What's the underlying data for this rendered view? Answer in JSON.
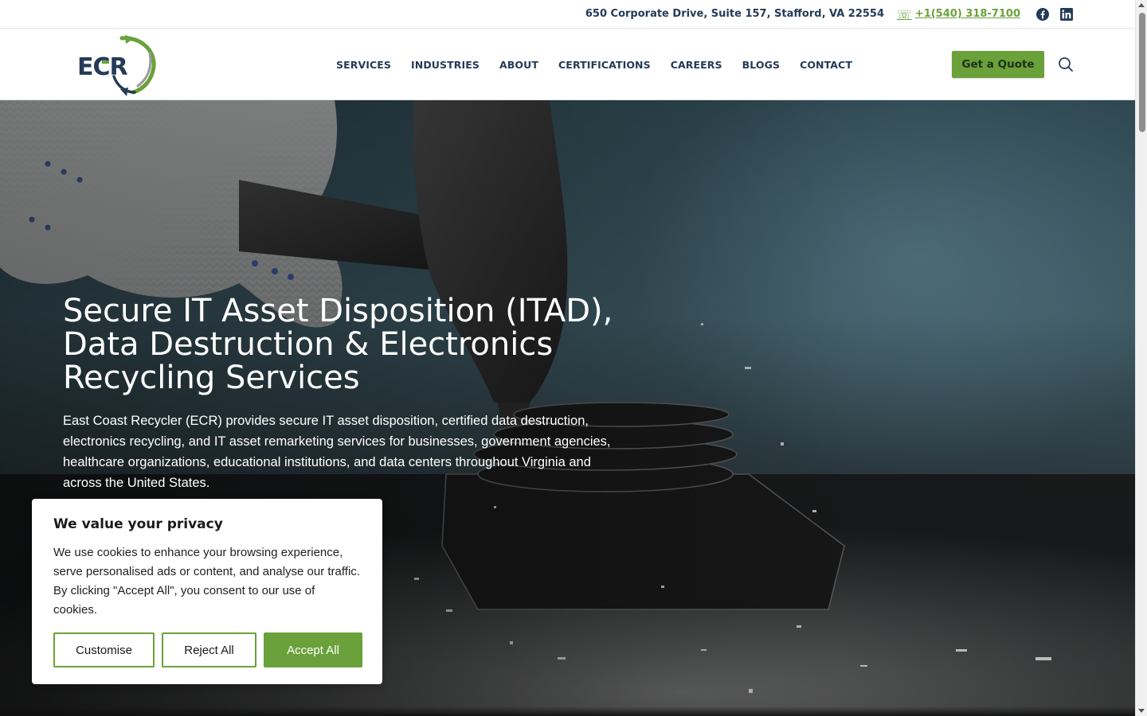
{
  "topbar": {
    "address": "650 Corporate Drive, Suite 157, Stafford, VA 22554",
    "phone_icon": "☏",
    "phone": "+1‪(540) 318-7100",
    "social": [
      "facebook-icon",
      "linkedin-icon"
    ]
  },
  "header": {
    "logo_text": "ECR",
    "nav": [
      "SERVICES",
      "INDUSTRIES",
      "ABOUT",
      "CERTIFICATIONS",
      "CAREERS",
      "BLOGS",
      "CONTACT"
    ],
    "quote_label": "Get a Quote",
    "search_icon": "search-icon"
  },
  "hero": {
    "title": "Secure IT Asset Disposition (ITAD), Data Destruction & Electronics Recycling Services",
    "description": "East Coast Recycler (ECR) provides secure IT asset disposition, certified data destruction, electronics recycling, and IT asset remarketing services for businesses, government agencies, healthcare organizations, educational institutions, and data centers throughout Virginia and across the United States."
  },
  "cookie": {
    "title": "We value your privacy",
    "text": "We use cookies to enhance your browsing experience, serve personalised ads or content, and analyse our traffic. By clicking \"Accept All\", you consent to our use of cookies.",
    "customise_label": "Customise",
    "reject_label": "Reject All",
    "accept_label": "Accept All"
  },
  "colors": {
    "brand_green": "#6aa13a",
    "brand_navy": "#243b58"
  }
}
